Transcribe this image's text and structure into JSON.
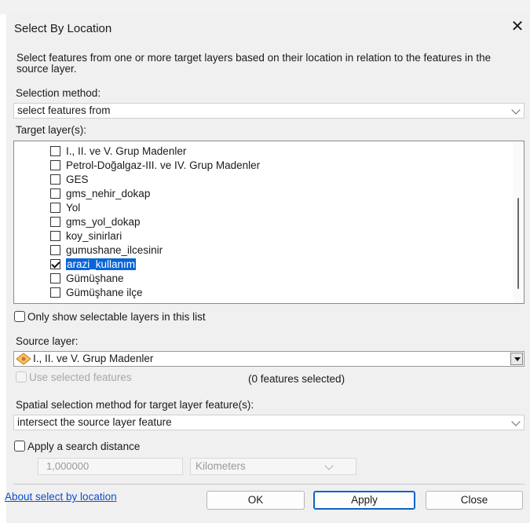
{
  "dialog": {
    "title": "Select By Location",
    "close_glyph": "✕",
    "description": "Select features from one or more target layers based on their location in relation to the features in the source layer."
  },
  "selection_method": {
    "label": "Selection method:",
    "value": "select features from"
  },
  "target_layers": {
    "label": "Target layer(s):",
    "items": [
      {
        "label": "I., II. ve V. Grup Madenler",
        "checked": false,
        "selected": false
      },
      {
        "label": "Petrol-Doğalgaz-III. ve IV. Grup Madenler",
        "checked": false,
        "selected": false
      },
      {
        "label": "GES",
        "checked": false,
        "selected": false
      },
      {
        "label": "gms_nehir_dokap",
        "checked": false,
        "selected": false
      },
      {
        "label": "Yol",
        "checked": false,
        "selected": false
      },
      {
        "label": "gms_yol_dokap",
        "checked": false,
        "selected": false
      },
      {
        "label": "koy_sinirlari",
        "checked": false,
        "selected": false
      },
      {
        "label": "gumushane_ilcesinir",
        "checked": false,
        "selected": false
      },
      {
        "label": "arazi_kullanım",
        "checked": true,
        "selected": true
      },
      {
        "label": "Gümüşhane",
        "checked": false,
        "selected": false
      },
      {
        "label": "Gümüşhane ilçe",
        "checked": false,
        "selected": false
      }
    ]
  },
  "only_selectable": {
    "label": "Only show selectable layers in this list",
    "checked": false
  },
  "source_layer": {
    "label": "Source layer:",
    "value": "I., II. ve V. Grup Madenler",
    "icon": "polygon-layer-icon"
  },
  "use_selected": {
    "label": "Use selected features",
    "enabled": false,
    "count_text": "(0 features selected)"
  },
  "spatial_method": {
    "label": "Spatial selection method for target layer feature(s):",
    "value": "intersect the source layer feature"
  },
  "search_distance": {
    "label": "Apply a search distance",
    "checked": false,
    "value": "1,000000",
    "unit": "Kilometers"
  },
  "footer": {
    "help_link": "About select by location",
    "ok": "OK",
    "apply": "Apply",
    "close": "Close"
  }
}
